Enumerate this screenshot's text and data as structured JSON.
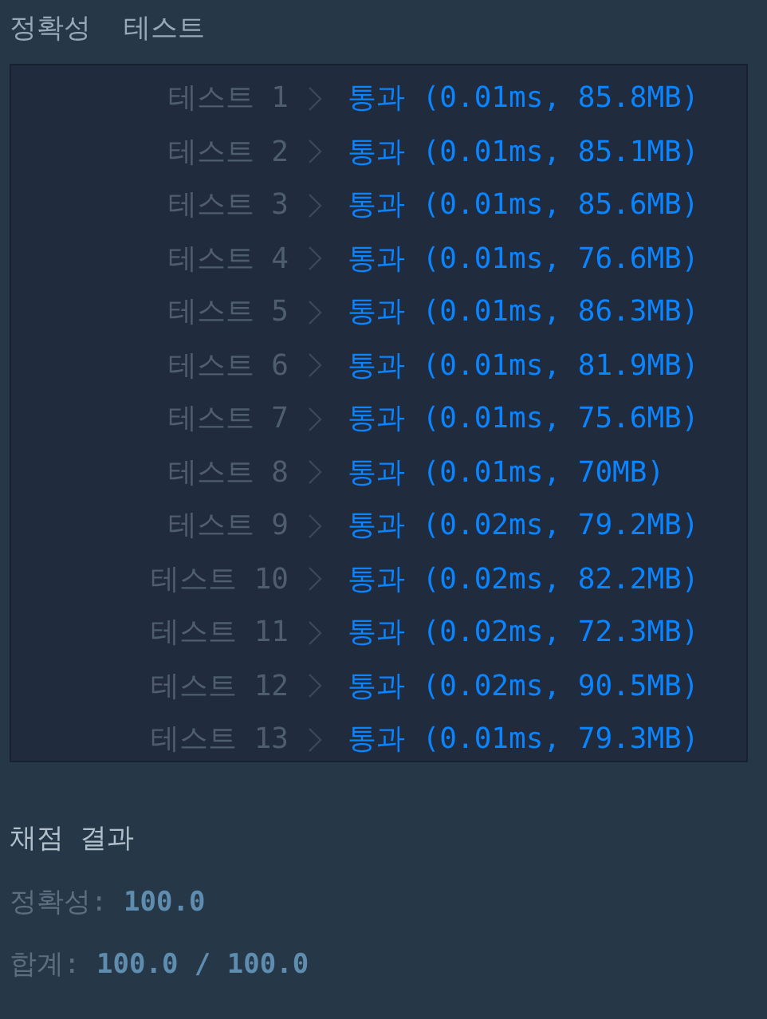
{
  "section_title": "정확성  테스트",
  "tests": [
    {
      "label": "테스트 1",
      "result": "통과 (0.01ms, 85.8MB)",
      "kind": "pass"
    },
    {
      "label": "테스트 2",
      "result": "통과 (0.01ms, 85.1MB)",
      "kind": "pass"
    },
    {
      "label": "테스트 3",
      "result": "통과 (0.01ms, 85.6MB)",
      "kind": "pass"
    },
    {
      "label": "테스트 4",
      "result": "통과 (0.01ms, 76.6MB)",
      "kind": "pass"
    },
    {
      "label": "테스트 5",
      "result": "통과 (0.01ms, 86.3MB)",
      "kind": "pass"
    },
    {
      "label": "테스트 6",
      "result": "통과 (0.01ms, 81.9MB)",
      "kind": "pass"
    },
    {
      "label": "테스트 7",
      "result": "통과 (0.01ms, 75.6MB)",
      "kind": "pass"
    },
    {
      "label": "테스트 8",
      "result": "통과 (0.01ms, 70MB)",
      "kind": "pass"
    },
    {
      "label": "테스트 9",
      "result": "통과 (0.02ms, 79.2MB)",
      "kind": "pass"
    },
    {
      "label": "테스트 10",
      "result": "통과 (0.02ms, 82.2MB)",
      "kind": "pass"
    },
    {
      "label": "테스트 11",
      "result": "통과 (0.02ms, 72.3MB)",
      "kind": "pass"
    },
    {
      "label": "테스트 12",
      "result": "통과 (0.02ms, 90.5MB)",
      "kind": "pass"
    },
    {
      "label": "테스트 13",
      "result": "통과 (0.01ms, 79.3MB)",
      "kind": "pass"
    }
  ],
  "grading": {
    "title": "채점 결과",
    "lines": [
      {
        "label": "정확성:",
        "value": "100.0"
      },
      {
        "label": "합계:",
        "value": "100.0 / 100.0"
      }
    ]
  }
}
